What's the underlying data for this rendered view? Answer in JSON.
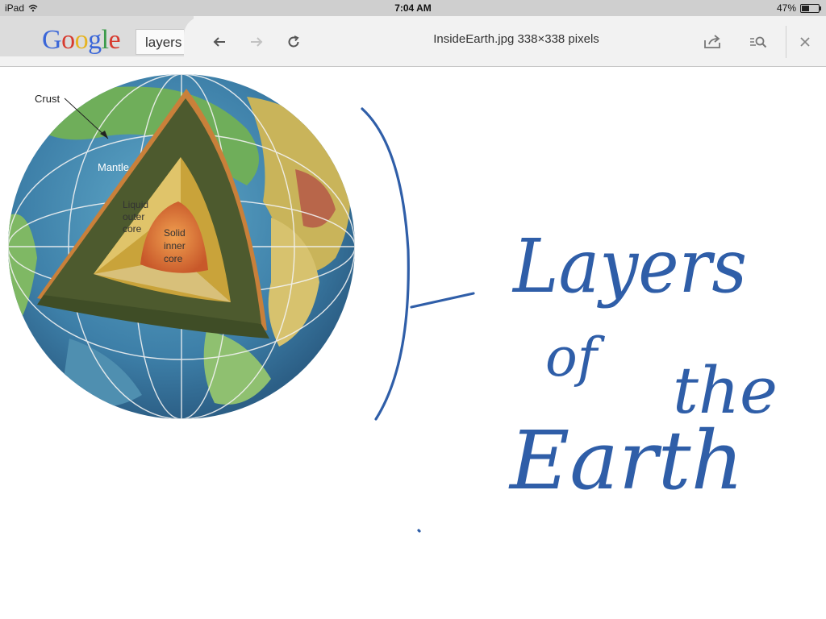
{
  "status_bar": {
    "device": "iPad",
    "time": "7:04 AM",
    "battery": "47%",
    "battery_level": 0.47
  },
  "browser": {
    "logo": {
      "l1": "G",
      "l2": "o",
      "l3": "o",
      "l4": "g",
      "l5": "l",
      "l6": "e"
    },
    "search_query": "layers of the earth",
    "page_title": "InsideEarth.jpg 338×338 pixels",
    "icons": [
      "back-arrow-icon",
      "forward-arrow-icon",
      "reload-icon",
      "share-icon",
      "search-in-page-icon",
      "close-icon"
    ]
  },
  "image": {
    "labels": {
      "crust": "Crust",
      "mantle": "Mantle",
      "outer_core_1": "Liquid",
      "outer_core_2": "outer",
      "outer_core_3": "core",
      "inner_core_1": "Solid",
      "inner_core_2": "inner",
      "inner_core_3": "core"
    }
  },
  "annotation": {
    "line1": "Layers",
    "line2a": "of",
    "line2b": "the",
    "line3": "Earth",
    "ink_color": "#2f5ea8"
  }
}
